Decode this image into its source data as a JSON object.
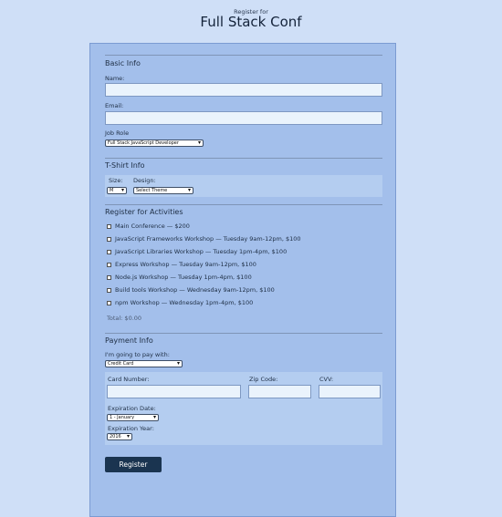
{
  "header": {
    "pre": "Register for",
    "title": "Full Stack Conf"
  },
  "basic": {
    "legend": "Basic Info",
    "name_label": "Name:",
    "email_label": "Email:",
    "role_label": "Job Role",
    "role_value": "Full Stack JavaScript Developer"
  },
  "shirt": {
    "legend": "T-Shirt Info",
    "size_label": "Size:",
    "size_value": "M",
    "design_label": "Design:",
    "design_value": "Select Theme"
  },
  "activities": {
    "legend": "Register for Activities",
    "items": [
      "Main Conference — $200",
      "JavaScript Frameworks Workshop — Tuesday 9am-12pm, $100",
      "JavaScript Libraries Workshop — Tuesday 1pm-4pm, $100",
      "Express Workshop — Tuesday 9am-12pm, $100",
      "Node.js Workshop — Tuesday 1pm-4pm, $100",
      "Build tools Workshop — Wednesday 9am-12pm, $100",
      "npm Workshop — Wednesday 1pm-4pm, $100"
    ],
    "total": "Total: $0.00"
  },
  "payment": {
    "legend": "Payment Info",
    "pay_label": "I'm going to pay with:",
    "pay_value": "Credit Card",
    "card_label": "Card Number:",
    "zip_label": "Zip Code:",
    "cvv_label": "CVV:",
    "exp_date_label": "Expiration Date:",
    "exp_date_value": "1 - January",
    "exp_year_label": "Expiration Year:",
    "exp_year_value": "2016"
  },
  "submit_label": "Register"
}
